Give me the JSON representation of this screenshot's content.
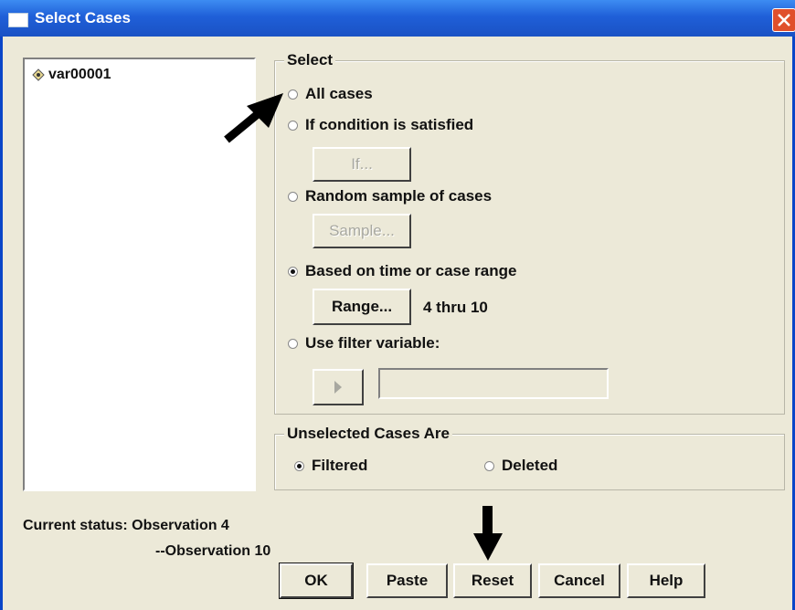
{
  "window": {
    "title": "Select Cases"
  },
  "variables": [
    {
      "name": "var00001"
    }
  ],
  "select_group": {
    "label": "Select",
    "options": [
      {
        "label": "All cases",
        "selected": false
      },
      {
        "label": "If condition is satisfied",
        "selected": false
      },
      {
        "label": "Random sample of cases",
        "selected": false
      },
      {
        "label": "Based on time or case range",
        "selected": true
      },
      {
        "label": "Use filter variable:",
        "selected": false
      }
    ],
    "if_button": "If...",
    "sample_button": "Sample...",
    "range_button": "Range...",
    "range_text": "4 thru 10",
    "filter_field_value": ""
  },
  "unselected_group": {
    "label": "Unselected Cases Are",
    "options": [
      {
        "label": "Filtered",
        "selected": true
      },
      {
        "label": "Deleted",
        "selected": false
      }
    ]
  },
  "status": {
    "line1": "Current status: Observation 4",
    "line2": "--Observation 10"
  },
  "buttons": {
    "ok": "OK",
    "paste": "Paste",
    "reset": "Reset",
    "cancel": "Cancel",
    "help": "Help"
  },
  "colors": {
    "titlebar": "#1f5fd8",
    "dialog_bg": "#ece9d8",
    "close": "#e0502c"
  },
  "icons": {
    "window": "window-icon",
    "close": "close-icon",
    "variable": "numeric-variable-icon",
    "move": "right-arrow-icon"
  }
}
